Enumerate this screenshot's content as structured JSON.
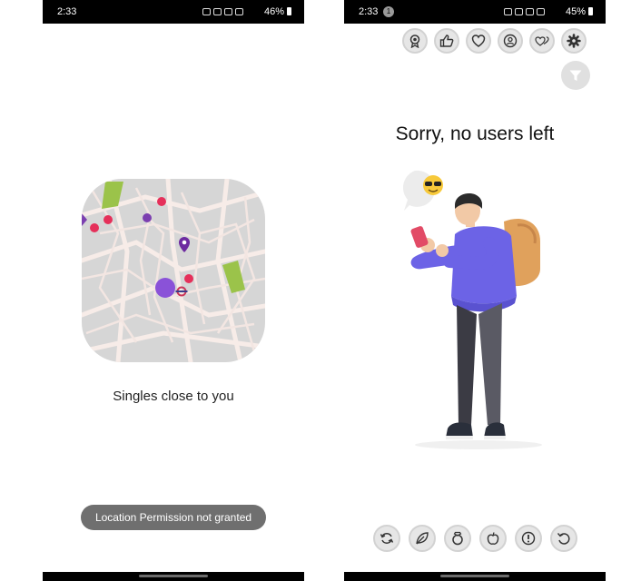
{
  "left_screen": {
    "status": {
      "time": "2:33",
      "battery": "46%"
    },
    "map_label": "Singles close to you",
    "toast": "Location Permission not granted"
  },
  "right_screen": {
    "status": {
      "time": "2:33",
      "notification_badge": "1",
      "battery": "45%"
    },
    "top_actions": [
      {
        "name": "badge-icon"
      },
      {
        "name": "thumbs-up-icon"
      },
      {
        "name": "heart-icon"
      },
      {
        "name": "profile-icon"
      },
      {
        "name": "double-heart-icon"
      },
      {
        "name": "gear-icon"
      }
    ],
    "filter": {
      "name": "filter-icon"
    },
    "empty_message": "Sorry, no users left",
    "bottom_actions": [
      {
        "name": "refresh-icon"
      },
      {
        "name": "leaf-icon"
      },
      {
        "name": "ring-icon"
      },
      {
        "name": "apple-icon"
      },
      {
        "name": "alert-icon"
      },
      {
        "name": "undo-icon"
      }
    ]
  },
  "colors": {
    "accent_purple": "#7b4ce0",
    "pin_pink": "#e5305a",
    "map_green": "#9bc34a",
    "status_bar": "#000000"
  }
}
